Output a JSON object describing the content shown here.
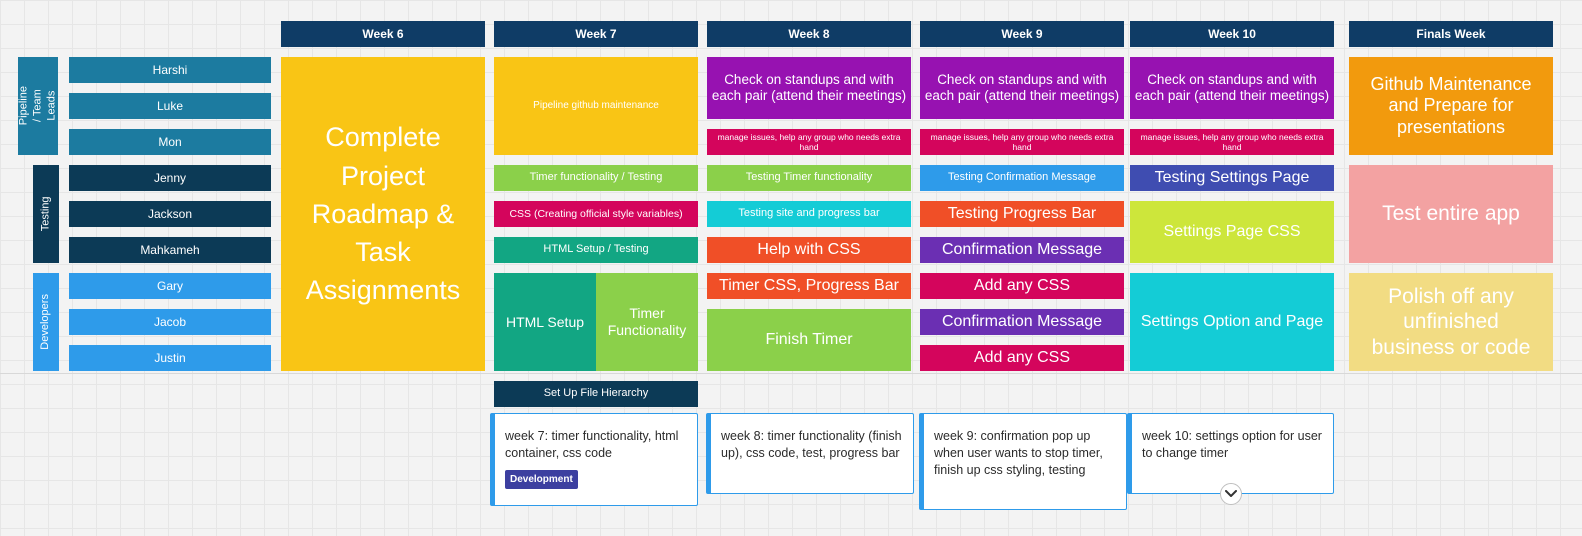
{
  "colors": {
    "header_navy": "#0f3c66",
    "leads_teal": "#1c7ba0",
    "testing_dark": "#0c3a56",
    "developers_blue": "#2e9bea",
    "yellow": "#f9c515",
    "purple": "#9712b1",
    "magenta": "#d4055c",
    "green": "#8bd04a",
    "emerald": "#12a683",
    "cyan": "#14ccd6",
    "orange_red": "#f04f27",
    "violet": "#6b2fb3",
    "indigo": "#3f4db1",
    "lime": "#cde63b",
    "orange": "#f29a0d",
    "pink": "#f3a2a2",
    "pale_yellow": "#f2dc83",
    "card_border": "#2e9bea"
  },
  "weeks": {
    "w6": "Week 6",
    "w7": "Week 7",
    "w8": "Week 8",
    "w9": "Week 9",
    "w10": "Week 10",
    "finals": "Finals Week"
  },
  "groups": {
    "leads": "Pipeline / Team Leads",
    "testing": "Testing",
    "developers": "Developers"
  },
  "people": {
    "harshi": "Harshi",
    "luke": "Luke",
    "mon": "Mon",
    "jenny": "Jenny",
    "jackson": "Jackson",
    "mahkameh": "Mahkameh",
    "gary": "Gary",
    "jacob": "Jacob",
    "justin": "Justin"
  },
  "tasks": {
    "w6_main": "Complete Project Roadmap & Task Assignments",
    "w7_pipeline": "Pipeline github maintenance",
    "w7_timer_testing": "Timer functionality / Testing",
    "w7_css": "CSS (Creating official style variables)",
    "w7_html_testing": "HTML Setup / Testing",
    "w7_html_setup": "HTML Setup",
    "w7_timer_func": "Timer Functionality",
    "w7_hierarchy": "Set Up File Hierarchy",
    "w8_standups": "Check on standups and with each pair (attend their meetings)",
    "w8_manage": "manage issues, help any group who needs extra hand",
    "w8_testing_timer": "Testing Timer functionality",
    "w8_testing_site": "Testing site and progress bar",
    "w8_help_css": "Help with CSS",
    "w8_timer_css": "Timer CSS, Progress Bar",
    "w8_finish_timer": "Finish Timer",
    "w9_standups": "Check on standups and with each pair (attend their meetings)",
    "w9_manage": "manage issues, help any group who needs extra hand",
    "w9_testing_confirm": "Testing Confirmation Message",
    "w9_testing_progress": "Testing Progress Bar",
    "w9_confirm_1": "Confirmation Message",
    "w9_add_css_1": "Add any CSS",
    "w9_confirm_2": "Confirmation Message",
    "w9_add_css_2": "Add any CSS",
    "w10_standups": "Check on standups and with each pair (attend their meetings)",
    "w10_manage": "manage issues, help any group who needs extra hand",
    "w10_testing_settings": "Testing Settings Page",
    "w10_settings_css": "Settings Page CSS",
    "w10_settings_option": "Settings Option and Page",
    "finals_github": "Github Maintenance and Prepare for presentations",
    "finals_test": "Test entire app",
    "finals_polish": "Polish off any unfinished business or code"
  },
  "cards": {
    "w7": "week 7: timer functionality, html container, css code",
    "w7_tag": "Development",
    "w8": "week 8: timer functionality (finish up), css code, test, progress bar",
    "w9": "week 9: confirmation pop up when user wants to stop timer, finish up css styling, testing",
    "w10": "week 10: settings option for user to change timer"
  },
  "icons": {
    "expand": "chevron-down-icon"
  }
}
